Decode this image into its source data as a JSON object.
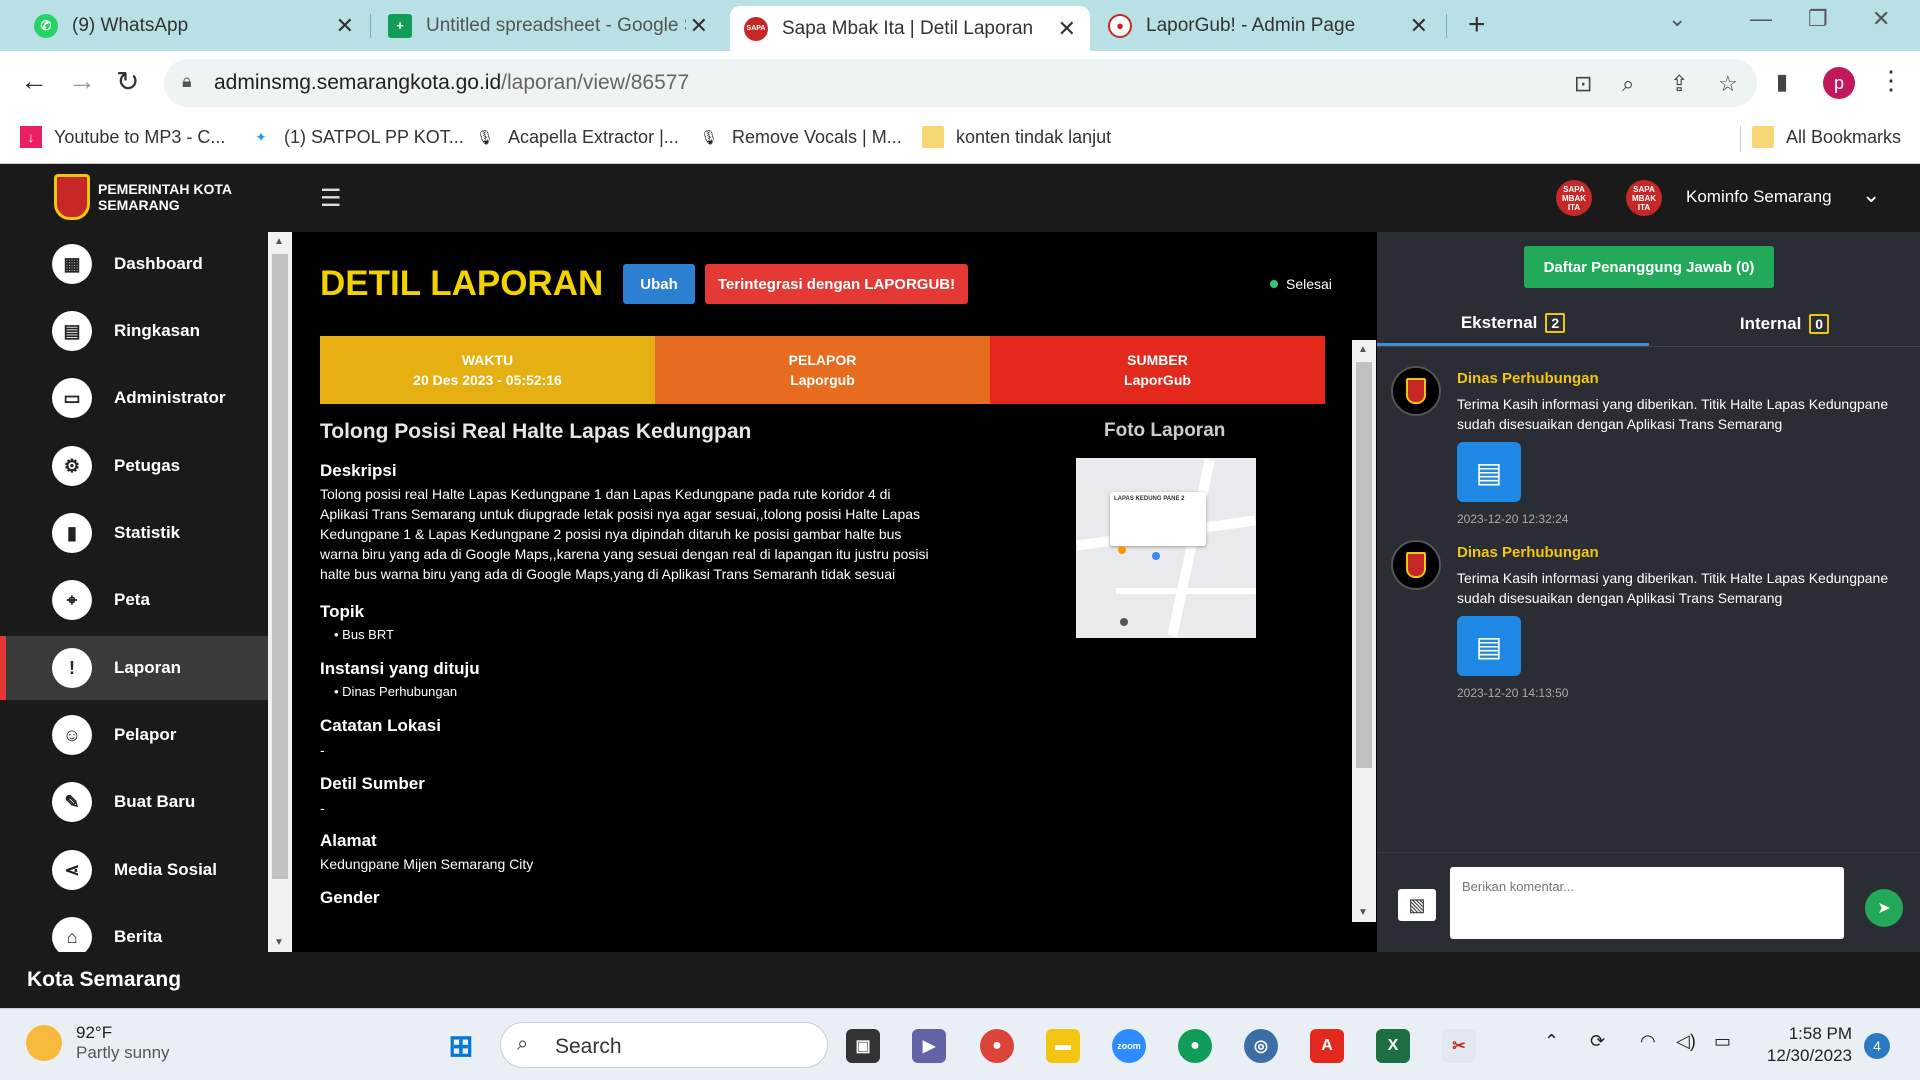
{
  "browser": {
    "tabs": [
      {
        "title": "(9) WhatsApp",
        "icon": "whatsapp-icon",
        "color": "#25d366"
      },
      {
        "title": "Untitled spreadsheet - Google Sheets",
        "icon": "sheets-icon",
        "color": "#0f9d58"
      },
      {
        "title": "Sapa Mbak Ita | Detil Laporan",
        "icon": "sapa-icon",
        "color": "#c62828"
      },
      {
        "title": "LaporGub! - Admin Page",
        "icon": "laporgub-icon",
        "color": "#c62828"
      }
    ],
    "url_host": "adminsmg.semarangkota.go.id",
    "url_path": "/laporan/view/86577",
    "profile_initial": "p",
    "bookmarks": [
      {
        "label": "Youtube to MP3 - C...",
        "icon": "download-icon"
      },
      {
        "label": "(1) SATPOL PP KOT...",
        "icon": "twitter-icon"
      },
      {
        "label": "Acapella Extractor |...",
        "icon": "mic-icon"
      },
      {
        "label": "Remove Vocals | M...",
        "icon": "mic-icon"
      },
      {
        "label": "konten tindak lanjut",
        "icon": "folder-icon"
      }
    ],
    "all_bookmarks": "All Bookmarks"
  },
  "app": {
    "logo_line1": "PEMERINTAH KOTA",
    "logo_line2": "SEMARANG",
    "sapa_logo_text": "SAPA MBAK ITA",
    "user_name": "Kominfo Semarang",
    "sidebar": [
      {
        "label": "Dashboard",
        "icon": "dashboard-icon",
        "glyph": "▦"
      },
      {
        "label": "Ringkasan",
        "icon": "summary-icon",
        "glyph": "▤"
      },
      {
        "label": "Administrator",
        "icon": "monitor-icon",
        "glyph": "▭"
      },
      {
        "label": "Petugas",
        "icon": "gear-icon",
        "glyph": "⚙"
      },
      {
        "label": "Statistik",
        "icon": "chart-icon",
        "glyph": "▮"
      },
      {
        "label": "Peta",
        "icon": "map-pin-icon",
        "glyph": "⌖"
      },
      {
        "label": "Laporan",
        "icon": "report-icon",
        "glyph": "!"
      },
      {
        "label": "Pelapor",
        "icon": "users-icon",
        "glyph": "☺"
      },
      {
        "label": "Buat Baru",
        "icon": "pencil-icon",
        "glyph": "✎"
      },
      {
        "label": "Media Sosial",
        "icon": "share-icon",
        "glyph": "⋖"
      },
      {
        "label": "Berita",
        "icon": "news-icon",
        "glyph": "⌂"
      }
    ],
    "active_sidebar": "Laporan",
    "footer": "Kota Semarang"
  },
  "report": {
    "page_title": "DETIL LAPORAN",
    "btn_ubah": "Ubah",
    "btn_integrasi": "Terintegrasi dengan LAPORGUB!",
    "status": "Selesai",
    "info": [
      {
        "label": "WAKTU",
        "value": "20 Des 2023 - 05:52:16",
        "color": "#e6b012"
      },
      {
        "label": "PELAPOR",
        "value": "Laporgub",
        "color": "#e86c1f"
      },
      {
        "label": "SUMBER",
        "value": "LaporGub",
        "color": "#e3281c"
      }
    ],
    "title": "Tolong Posisi Real Halte Lapas Kedungpan",
    "foto_label": "Foto Laporan",
    "map_card_title": "LAPAS KEDUNG PANE 2",
    "deskripsi_label": "Deskripsi",
    "deskripsi_lines": [
      "Tolong posisi real Halte Lapas Kedungpane 1 dan Lapas Kedungpane pada rute koridor 4 di",
      "Aplikasi Trans Semarang untuk diupgrade letak posisi nya agar sesuai,,tolong posisi Halte Lapas",
      "Kedungpane 1 & Lapas Kedungpane 2 posisi nya dipindah ditaruh ke posisi gambar halte bus",
      "warna biru yang ada di Google Maps,,karena yang sesuai dengan real di lapangan itu justru posisi",
      "halte bus warna biru yang ada di Google Maps,yang di Aplikasi Trans Semaranh tidak sesuai"
    ],
    "topik_label": "Topik",
    "topik_value": "Bus BRT",
    "instansi_label": "Instansi yang dituju",
    "instansi_value": "Dinas Perhubungan",
    "catatan_label": "Catatan Lokasi",
    "catatan_value": "-",
    "detil_sumber_label": "Detil Sumber",
    "detil_sumber_value": "-",
    "alamat_label": "Alamat",
    "alamat_value": "Kedungpane Mijen Semarang City",
    "gender_label": "Gender"
  },
  "panel": {
    "btn_penanggung": "Daftar Penanggung Jawab (0)",
    "tab_eksternal": "Eksternal",
    "tab_eksternal_count": "2",
    "tab_internal": "Internal",
    "tab_internal_count": "0",
    "comments": [
      {
        "name": "Dinas Perhubungan",
        "text": "Terima Kasih informasi yang diberikan. Titik Halte Lapas Kedungpane sudah disesuaikan dengan Aplikasi Trans Semarang",
        "time": "2023-12-20 12:32:24"
      },
      {
        "name": "Dinas Perhubungan",
        "text": "Terima Kasih informasi yang diberikan. Titik Halte Lapas Kedungpane sudah disesuaikan dengan Aplikasi Trans Semarang",
        "time": "2023-12-20 14:13:50"
      }
    ],
    "comment_placeholder": "Berikan komentar..."
  },
  "taskbar": {
    "temp": "92°F",
    "weather": "Partly sunny",
    "search": "Search",
    "time": "1:58 PM",
    "date": "12/30/2023",
    "notifications": "4"
  }
}
